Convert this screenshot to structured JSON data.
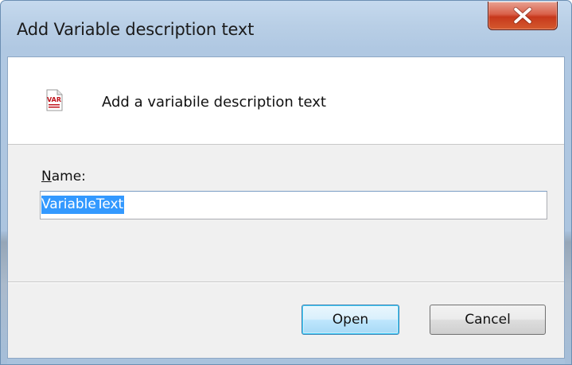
{
  "window": {
    "title": "Add Variable description text"
  },
  "header": {
    "icon": "var-file-icon",
    "icon_text": "VAR",
    "text": "Add a variabile description text"
  },
  "form": {
    "name_label_mnemonic": "N",
    "name_label_rest": "ame:",
    "name_value": "VariableText"
  },
  "buttons": {
    "open_label": "Open",
    "cancel_label": "Cancel"
  },
  "colors": {
    "selection": "#3399ff",
    "close_button": "#c7381c",
    "title_bar": "#b9cfe6"
  }
}
